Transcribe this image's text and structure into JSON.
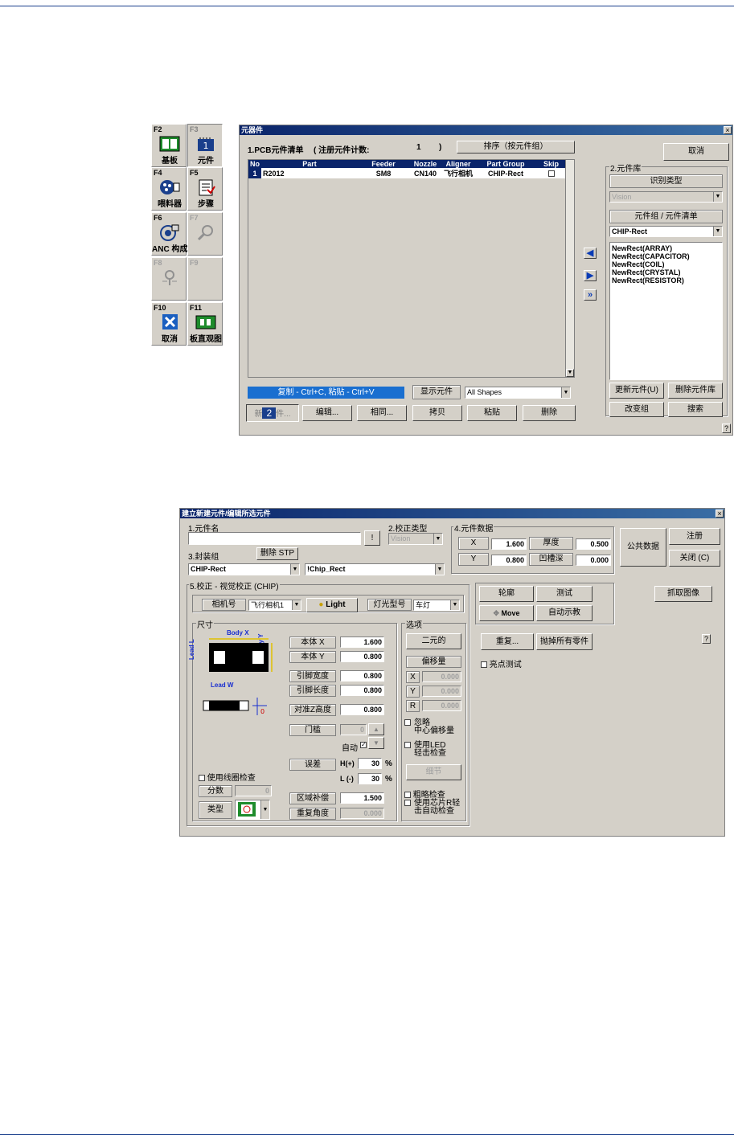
{
  "function_keys": [
    {
      "key": "F2",
      "label": "基板",
      "icon": "board-icon",
      "disabled": false
    },
    {
      "key": "F3",
      "label": "元件",
      "icon": "component-icon",
      "badge": "1",
      "disabled": false
    },
    {
      "key": "F4",
      "label": "喂料器",
      "icon": "feeder-icon",
      "disabled": false
    },
    {
      "key": "F5",
      "label": "步骤",
      "icon": "steps-icon",
      "disabled": false
    },
    {
      "key": "F6",
      "label": "ANC 构成",
      "icon": "anc-icon",
      "disabled": false
    },
    {
      "key": "F7",
      "label": "",
      "icon": "magnifier-icon",
      "disabled": true
    },
    {
      "key": "F8",
      "label": "",
      "icon": "nozzle-icon",
      "disabled": true
    },
    {
      "key": "F9",
      "label": "",
      "icon": "",
      "disabled": true
    },
    {
      "key": "F10",
      "label": "取消",
      "icon": "cancel-x-icon",
      "disabled": false
    },
    {
      "key": "F11",
      "label": "板直观图",
      "icon": "board-view-icon",
      "disabled": false
    }
  ],
  "component_window": {
    "title": "元器件",
    "pcb_list_label": "1.PCB元件清单",
    "register_count_label": "( 注册元件计数:",
    "register_count": "1",
    "register_count_close": ")",
    "sort_button": "排序（按元件组）",
    "cancel_button": "取消",
    "columns": [
      "No",
      "Part",
      "Feeder",
      "Nozzle",
      "Aligner",
      "Part Group",
      "Skip"
    ],
    "rows": [
      {
        "no": "1",
        "part": "R2012",
        "feeder": "SM8",
        "nozzle": "CN140",
        "aligner": "飞行相机",
        "group": "CHIP-Rect",
        "skip": ""
      }
    ],
    "copy_paste_hint": "复制 - Ctrl+C, 粘贴 - Ctrl+V",
    "show_parts_label": "显示元件",
    "show_parts_value": "All Shapes",
    "bottom_buttons": [
      "新",
      "件...",
      "编辑...",
      "相同...",
      "拷贝",
      "粘贴",
      "删除"
    ],
    "new_badge": "2",
    "library": {
      "title": "2.元件库",
      "recognition_type_button": "识别类型",
      "recognition_type_value": "Vision",
      "group_list_button": "元件组 / 元件清单",
      "group_value": "CHIP-Rect",
      "items": [
        "NewRect(ARRAY)",
        "NewRect(CAPACITOR)",
        "NewRect(COIL)",
        "NewRect(CRYSTAL)",
        "NewRect(RESISTOR)"
      ],
      "update_button": "更新元件(U)",
      "delete_button": "删除元件库",
      "change_group_button": "改变组",
      "search_button": "搜索"
    },
    "help": "?"
  },
  "edit_window": {
    "title": "建立新建元件/编辑所选元件",
    "name_label": "1.元件名",
    "name_value": "",
    "name_button": "!",
    "calib_type_label": "2.校正类型",
    "calib_type_value": "Vision",
    "package_label": "3.封装组",
    "delete_stp_button": "删除  STP",
    "package_value": "CHIP-Rect",
    "package2_value": "!Chip_Rect",
    "part_data_label": "4.元件数据",
    "x_label": "X",
    "x_value": "1.600",
    "y_label": "Y",
    "y_value": "0.800",
    "thickness_label": "厚度",
    "thickness_value": "0.500",
    "groove_label": "凹槽深",
    "groove_value": "0.000",
    "common_data_button": "公共数据",
    "register_button": "注册",
    "close_button": "关闭 (C)",
    "vision_title": "5.校正 - 视觉校正 (CHIP)",
    "camera_label": "相机号",
    "camera_value": "飞行相机1",
    "light_button": "Light",
    "light_type_label": "灯光型号",
    "light_type_value": "车灯",
    "size_title": "尺寸",
    "body_x_tag": "Body X",
    "body_y_tag": "Body Y",
    "lead_l_tag": "Lead L",
    "lead_w_tag": "Lead W",
    "fields": [
      {
        "label": "本体 X",
        "value": "1.600"
      },
      {
        "label": "本体 Y",
        "value": "0.800"
      },
      {
        "label": "引脚宽度",
        "value": "0.800"
      },
      {
        "label": "引脚长度",
        "value": "0.800"
      },
      {
        "label": "对准Z高度",
        "value": "0.800"
      }
    ],
    "threshold_label": "门槛",
    "threshold_value": "0",
    "auto_label": "自动",
    "error_label": "误差",
    "h_label": "H(+)",
    "h_value": "30",
    "l_label": "L (-)",
    "l_value": "30",
    "percent": "%",
    "region_label": "区域补偿",
    "region_value": "1.500",
    "repeat_angle_label": "重复角度",
    "repeat_angle_value": "0.000",
    "coil_check_label": "使用线圈检查",
    "score_label": "分数",
    "score_value": "0",
    "type_label": "类型",
    "options_title": "选项",
    "binary_button": "二元的",
    "offset_button": "偏移量",
    "x_off_label": "X",
    "x_off_value": "0.000",
    "y_off_label": "Y",
    "y_off_value": "0.000",
    "r_off_label": "R",
    "r_off_value": "0.000",
    "ignore_center_label": "忽略\n中心偏移量",
    "use_led_label": "使用LED\n轻击检查",
    "detail_button": "细节",
    "rough_check_label": "粗略检查",
    "chip_r_check_label": "使用芯片R轻\n击自动检查",
    "outline_button": "轮廓",
    "test_button": "测试",
    "grab_button": "抓取图像",
    "move_button": "Move",
    "auto_teach_button": "自动示教",
    "repeat_button": "重复...",
    "discard_button": "抛掉所有零件",
    "bright_test_label": "亮点测试",
    "help": "?"
  }
}
